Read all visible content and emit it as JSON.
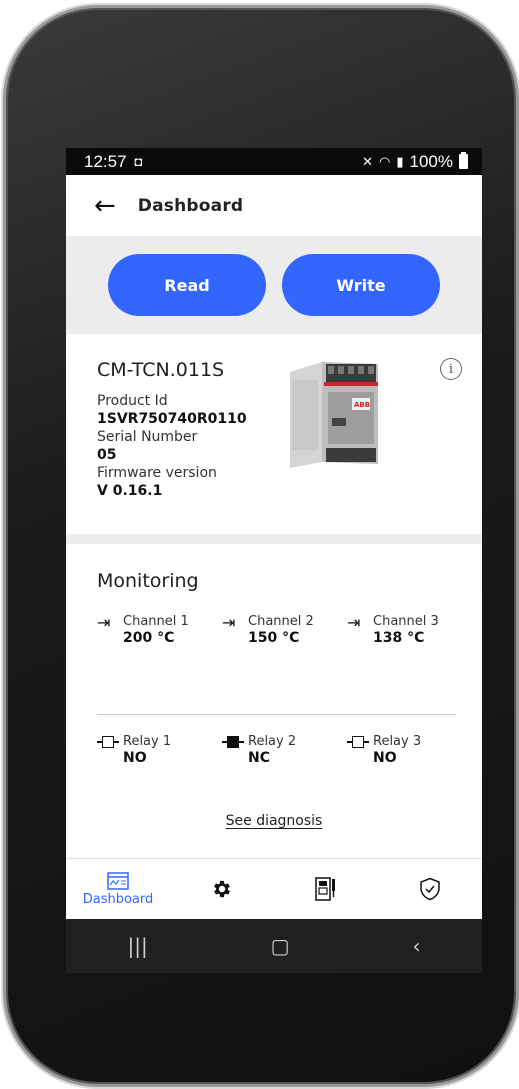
{
  "status_bar": {
    "time": "12:57",
    "battery": "100%"
  },
  "header": {
    "title": "Dashboard"
  },
  "actions": {
    "read_label": "Read",
    "write_label": "Write"
  },
  "product": {
    "name": "CM-TCN.011S",
    "product_id_label": "Product Id",
    "product_id": "1SVR750740R0110",
    "serial_label": "Serial Number",
    "serial": "05",
    "firmware_label": "Firmware version",
    "firmware": "V 0.16.1",
    "device_brand": "ABB"
  },
  "monitoring": {
    "title": "Monitoring",
    "channels": [
      {
        "label": "Channel 1",
        "value": "200 °C"
      },
      {
        "label": "Channel 2",
        "value": "150 °C"
      },
      {
        "label": "Channel 3",
        "value": "138 °C"
      }
    ],
    "relays": [
      {
        "label": "Relay 1",
        "value": "NO",
        "state": "open"
      },
      {
        "label": "Relay 2",
        "value": "NC",
        "state": "closed"
      },
      {
        "label": "Relay 3",
        "value": "NO",
        "state": "open"
      }
    ],
    "diagnosis_link": "See diagnosis"
  },
  "bottom_nav": {
    "items": [
      {
        "label": "Dashboard",
        "icon": "dashboard-icon",
        "active": true
      },
      {
        "label": "",
        "icon": "gear-icon",
        "active": false
      },
      {
        "label": "",
        "icon": "device-icon",
        "active": false
      },
      {
        "label": "",
        "icon": "shield-check-icon",
        "active": false
      }
    ]
  },
  "colors": {
    "accent": "#3366ff",
    "band": "#ececec"
  }
}
